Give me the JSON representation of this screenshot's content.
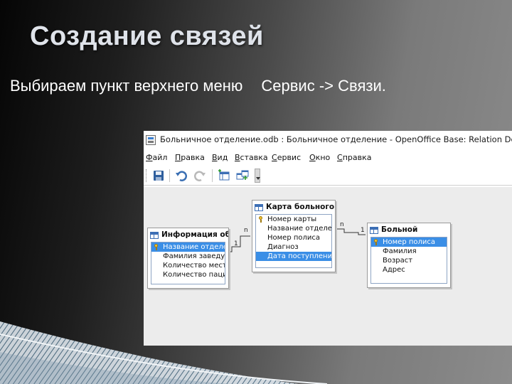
{
  "slide": {
    "title": "Создание связей",
    "subtitle_part1": "Выбираем пункт верхнего меню",
    "subtitle_part2": "Сервис -> Связи."
  },
  "window": {
    "title": "Больничное отделение.odb : Больничное отделение - OpenOffice Base: Relation Design",
    "menu": [
      "Файл",
      "Правка",
      "Вид",
      "Вставка",
      "Сервис",
      "Окно",
      "Справка"
    ],
    "toolbar_icons": [
      "save-icon",
      "undo-icon",
      "redo-icon",
      "new-relation-icon",
      "add-tables-icon"
    ]
  },
  "tables": {
    "info": {
      "name": "Информация об",
      "fields": [
        "Название отделе",
        "Фамилия заведу",
        "Количество мест",
        "Количество паци"
      ],
      "selected": 0,
      "key": 0
    },
    "card": {
      "name": "Карта больного",
      "fields": [
        "Номер карты",
        "Название отделе",
        "Номер полиса",
        "Диагноз",
        "Дата поступлени"
      ],
      "selected": 4,
      "key": 0
    },
    "patient": {
      "name": "Больной",
      "fields": [
        "Номер полиса",
        "Фамилия",
        "Возраст",
        "Адрес"
      ],
      "selected": 0,
      "key": 0
    }
  },
  "relations": {
    "rel1": {
      "left": "1",
      "right": "n"
    },
    "rel2": {
      "left": "n",
      "right": "1"
    }
  },
  "colors": {
    "selection": "#3a8ee6",
    "title_text": "#dfe3ea"
  }
}
